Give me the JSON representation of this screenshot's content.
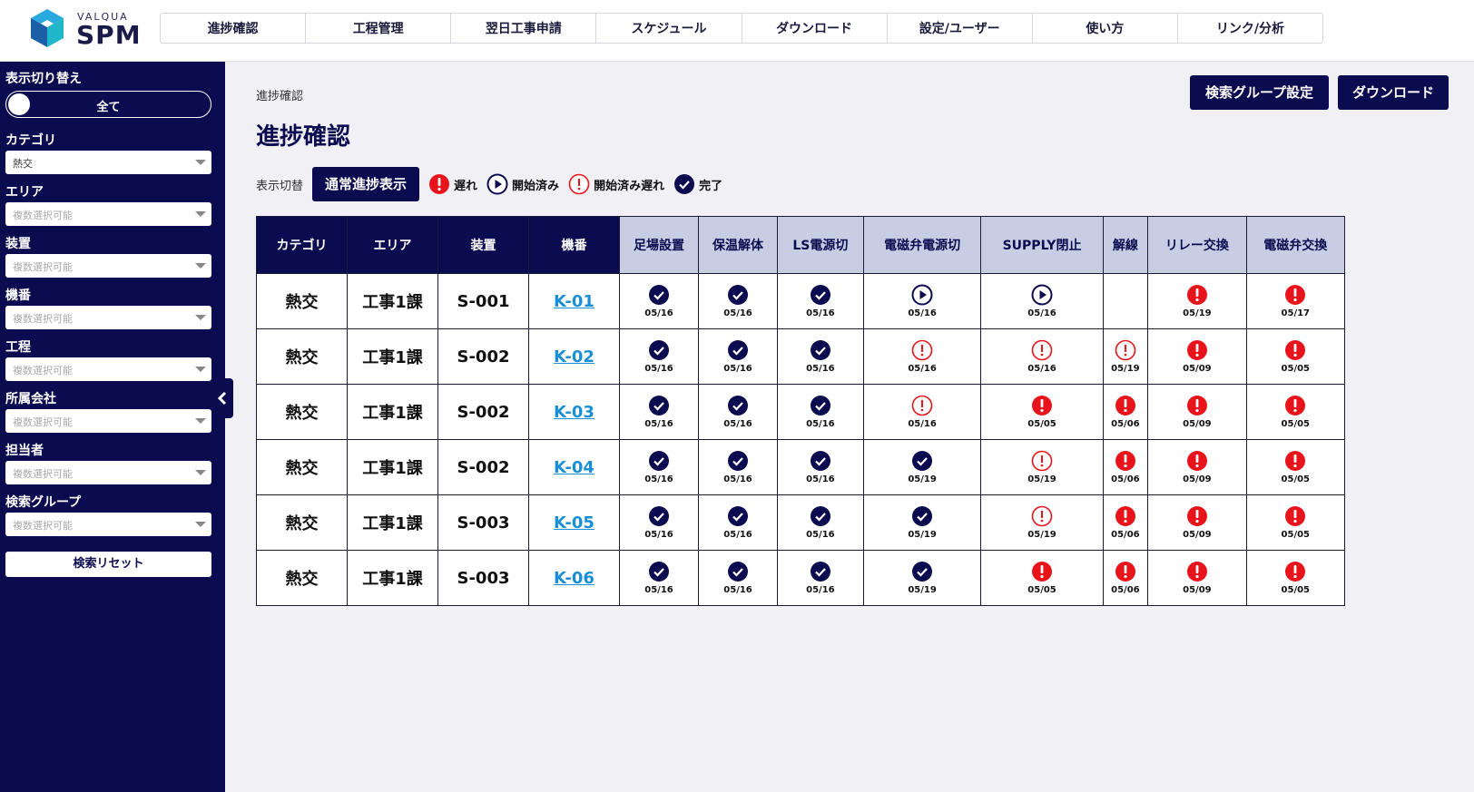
{
  "brand": {
    "sub": "VALQUA",
    "main": "SPM"
  },
  "nav": [
    "進捗確認",
    "工程管理",
    "翌日工事申請",
    "スケジュール",
    "ダウンロード",
    "設定/ユーザー",
    "使い方",
    "リンク/分析"
  ],
  "sidebar": {
    "toggle_title": "表示切り替え",
    "toggle_value": "全て",
    "filters": [
      {
        "label": "カテゴリ",
        "value": "熱交",
        "placeholder": false
      },
      {
        "label": "エリア",
        "value": "複数選択可能",
        "placeholder": true
      },
      {
        "label": "装置",
        "value": "複数選択可能",
        "placeholder": true
      },
      {
        "label": "機番",
        "value": "複数選択可能",
        "placeholder": true
      },
      {
        "label": "工程",
        "value": "複数選択可能",
        "placeholder": true
      },
      {
        "label": "所属会社",
        "value": "複数選択可能",
        "placeholder": true
      },
      {
        "label": "担当者",
        "value": "複数選択可能",
        "placeholder": true
      },
      {
        "label": "検索グループ",
        "value": "複数選択可能",
        "placeholder": true
      }
    ],
    "reset_label": "検索リセット"
  },
  "main": {
    "breadcrumb": "進捗確認",
    "title": "進捗確認",
    "search_group_button": "検索グループ設定",
    "download_button": "ダウンロード",
    "legend_label": "表示切替",
    "legend_mode_button": "通常進捗表示",
    "legend": [
      {
        "icon": "late",
        "label": "遅れ"
      },
      {
        "icon": "started",
        "label": "開始済み"
      },
      {
        "icon": "started-late",
        "label": "開始済み遅れ"
      },
      {
        "icon": "done",
        "label": "完了"
      }
    ]
  },
  "table": {
    "fixed_headers": [
      "カテゴリ",
      "エリア",
      "装置",
      "機番"
    ],
    "step_headers": [
      "足場設置",
      "保温解体",
      "LS電源切",
      "電磁弁電源切",
      "SUPPLY閉止",
      "解線",
      "リレー交換",
      "電磁弁交換"
    ],
    "rows": [
      {
        "category": "熱交",
        "area": "工事1課",
        "device": "S-001",
        "machine": "K-01",
        "steps": [
          {
            "s": "done",
            "d": "05/16"
          },
          {
            "s": "done",
            "d": "05/16"
          },
          {
            "s": "done",
            "d": "05/16"
          },
          {
            "s": "started",
            "d": "05/16"
          },
          {
            "s": "started",
            "d": "05/16"
          },
          {
            "s": "none",
            "d": ""
          },
          {
            "s": "late",
            "d": "05/19"
          },
          {
            "s": "late",
            "d": "05/17"
          }
        ]
      },
      {
        "category": "熱交",
        "area": "工事1課",
        "device": "S-002",
        "machine": "K-02",
        "steps": [
          {
            "s": "done",
            "d": "05/16"
          },
          {
            "s": "done",
            "d": "05/16"
          },
          {
            "s": "done",
            "d": "05/16"
          },
          {
            "s": "started-late",
            "d": "05/16"
          },
          {
            "s": "started-late",
            "d": "05/16"
          },
          {
            "s": "started-late",
            "d": "05/19"
          },
          {
            "s": "late",
            "d": "05/09"
          },
          {
            "s": "late",
            "d": "05/05"
          }
        ]
      },
      {
        "category": "熱交",
        "area": "工事1課",
        "device": "S-002",
        "machine": "K-03",
        "steps": [
          {
            "s": "done",
            "d": "05/16"
          },
          {
            "s": "done",
            "d": "05/16"
          },
          {
            "s": "done",
            "d": "05/16"
          },
          {
            "s": "started-late",
            "d": "05/16"
          },
          {
            "s": "late",
            "d": "05/05"
          },
          {
            "s": "late",
            "d": "05/06"
          },
          {
            "s": "late",
            "d": "05/09"
          },
          {
            "s": "late",
            "d": "05/05"
          }
        ]
      },
      {
        "category": "熱交",
        "area": "工事1課",
        "device": "S-002",
        "machine": "K-04",
        "steps": [
          {
            "s": "done",
            "d": "05/16"
          },
          {
            "s": "done",
            "d": "05/16"
          },
          {
            "s": "done",
            "d": "05/16"
          },
          {
            "s": "done",
            "d": "05/19"
          },
          {
            "s": "started-late",
            "d": "05/19"
          },
          {
            "s": "late",
            "d": "05/06"
          },
          {
            "s": "late",
            "d": "05/09"
          },
          {
            "s": "late",
            "d": "05/05"
          }
        ]
      },
      {
        "category": "熱交",
        "area": "工事1課",
        "device": "S-003",
        "machine": "K-05",
        "steps": [
          {
            "s": "done",
            "d": "05/16"
          },
          {
            "s": "done",
            "d": "05/16"
          },
          {
            "s": "done",
            "d": "05/16"
          },
          {
            "s": "done",
            "d": "05/19"
          },
          {
            "s": "started-late",
            "d": "05/19"
          },
          {
            "s": "late",
            "d": "05/06"
          },
          {
            "s": "late",
            "d": "05/09"
          },
          {
            "s": "late",
            "d": "05/05"
          }
        ]
      },
      {
        "category": "熱交",
        "area": "工事1課",
        "device": "S-003",
        "machine": "K-06",
        "steps": [
          {
            "s": "done",
            "d": "05/16"
          },
          {
            "s": "done",
            "d": "05/16"
          },
          {
            "s": "done",
            "d": "05/16"
          },
          {
            "s": "done",
            "d": "05/19"
          },
          {
            "s": "late",
            "d": "05/05"
          },
          {
            "s": "late",
            "d": "05/06"
          },
          {
            "s": "late",
            "d": "05/09"
          },
          {
            "s": "late",
            "d": "05/05"
          }
        ]
      }
    ]
  },
  "colors": {
    "navy": "#0b0b50",
    "late": "#e8141c",
    "link": "#1a8fd6",
    "header_light": "#c7cde3"
  }
}
